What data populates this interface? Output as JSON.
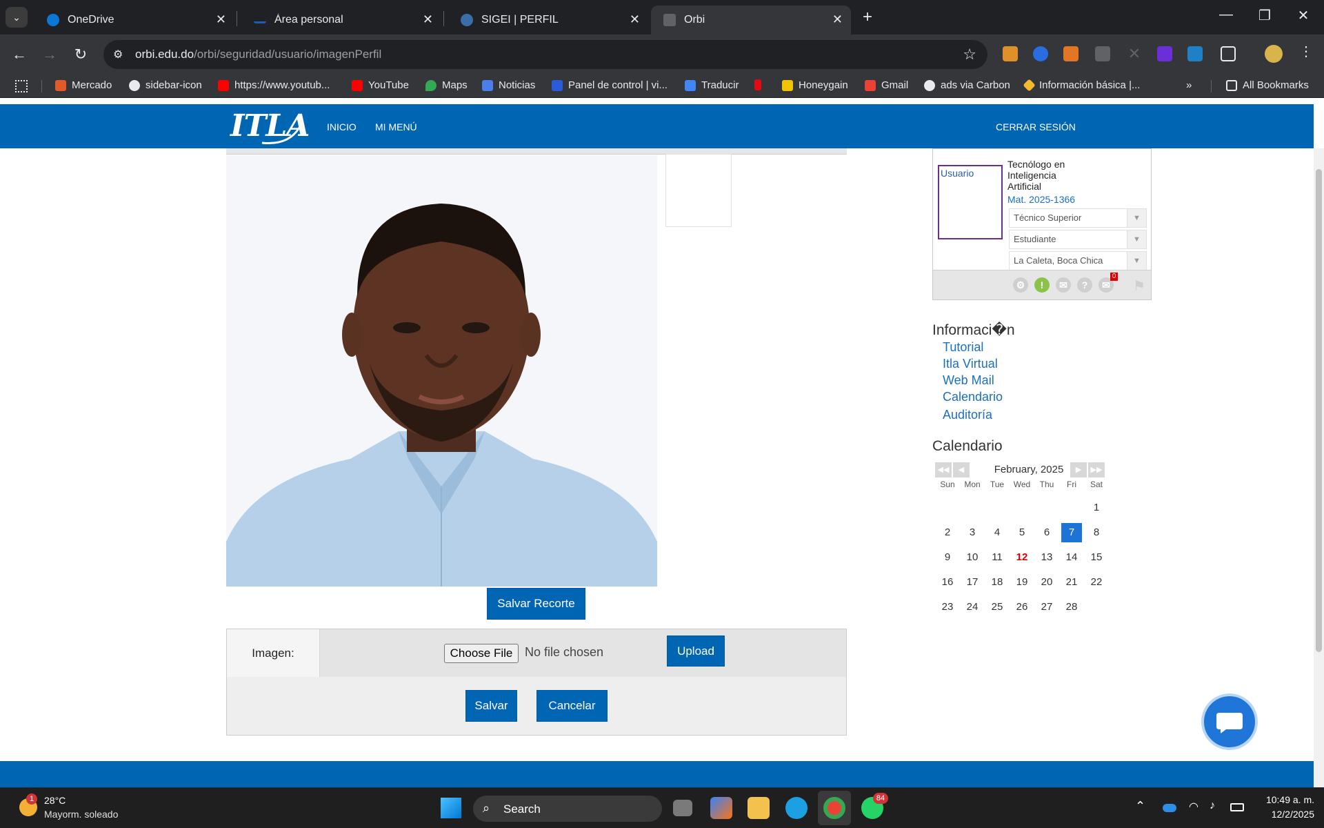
{
  "browser": {
    "tabs": [
      {
        "title": "OneDrive",
        "active": false
      },
      {
        "title": "Área personal",
        "active": false
      },
      {
        "title": "SIGEI | PERFIL",
        "active": false
      },
      {
        "title": "Orbi",
        "active": true
      }
    ],
    "url_host": "orbi.edu.do",
    "url_path": "/orbi/seguridad/usuario/imagenPerfil",
    "bookmarks": [
      "Mercado",
      "sidebar-icon",
      "https://www.youtub...",
      "YouTube",
      "Maps",
      "Noticias",
      "Panel de control | vi...",
      "Traducir",
      "Honeygain",
      "Gmail",
      "ads via Carbon",
      "Información básica |..."
    ],
    "all_bookmarks": "All Bookmarks"
  },
  "site": {
    "logo": "ITLA",
    "nav": {
      "inicio": "INICIO",
      "mi_menu": "MI MENÚ",
      "logout": "CERRAR SESIÓN"
    }
  },
  "editor": {
    "photo_alt": "profile photo",
    "save_crop": "Salvar Recorte",
    "image_label": "Imagen:",
    "choose_file": "Choose File",
    "no_file": "No file chosen",
    "upload": "Upload",
    "save": "Salvar",
    "cancel": "Cancelar"
  },
  "profile": {
    "avatar_alt": "Usuario",
    "career": "Tecnólogo en Inteligencia Artificial",
    "matricula": "Mat. 2025-1366",
    "level": "Técnico Superior",
    "role": "Estudiante",
    "campus": "La Caleta, Boca Chica",
    "notification_count": "0"
  },
  "info": {
    "title": "Informaci�n",
    "links": [
      "Tutorial",
      "Itla Virtual",
      "Web Mail",
      "Calendario",
      "Auditoría"
    ]
  },
  "calendar": {
    "title": "Calendario",
    "month": "February, 2025",
    "dow": [
      "Sun",
      "Mon",
      "Tue",
      "Wed",
      "Thu",
      "Fri",
      "Sat"
    ],
    "weeks": [
      [
        "",
        "",
        "",
        "",
        "",
        "",
        "1"
      ],
      [
        "2",
        "3",
        "4",
        "5",
        "6",
        "7",
        "8"
      ],
      [
        "9",
        "10",
        "11",
        "12",
        "13",
        "14",
        "15"
      ],
      [
        "16",
        "17",
        "18",
        "19",
        "20",
        "21",
        "22"
      ],
      [
        "23",
        "24",
        "25",
        "26",
        "27",
        "28",
        ""
      ]
    ],
    "selected_day": "7",
    "highlight_day": "12"
  },
  "taskbar": {
    "weather_badge": "1",
    "temperature": "28°C",
    "weather": "Mayorm. soleado",
    "search": "Search",
    "whatsapp_badge": "84",
    "time": "10:49 a. m.",
    "date": "12/2/2025"
  },
  "colors": {
    "brand_blue": "#0066b3",
    "link_blue": "#1a6fc0",
    "today_blue": "#1e74d6",
    "highlight_red": "#e00000"
  }
}
